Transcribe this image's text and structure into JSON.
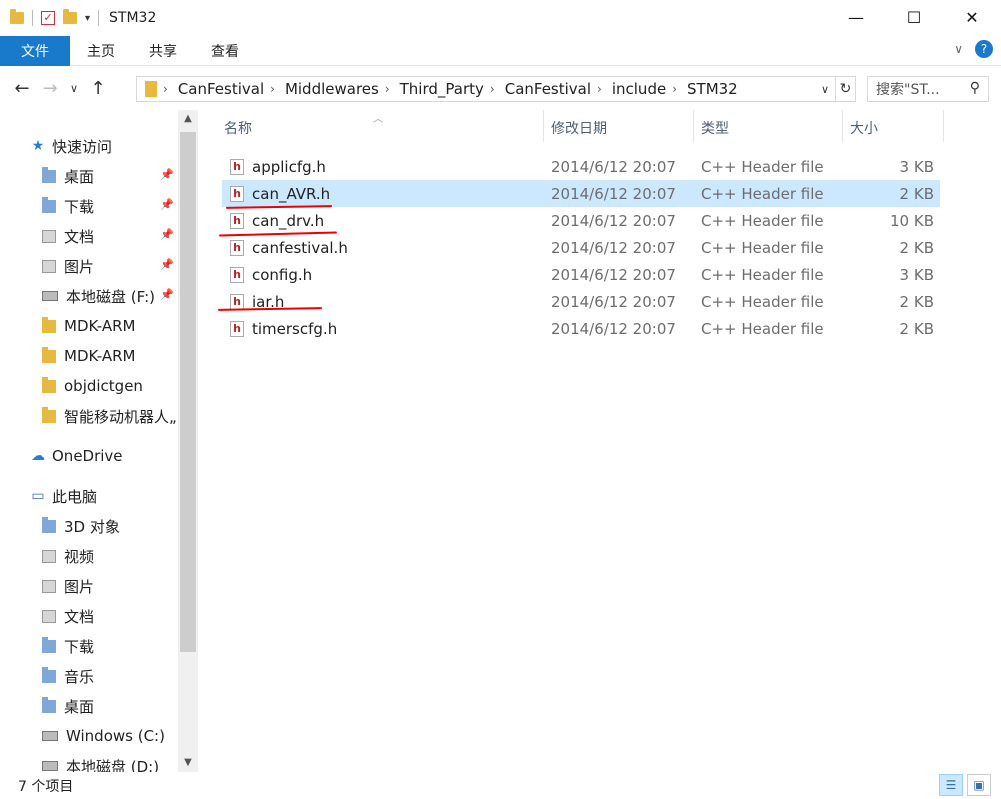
{
  "window": {
    "title": "STM32",
    "controls": {
      "minimize": "—",
      "maximize": "☐",
      "close": "✕"
    }
  },
  "ribbon": {
    "tabs": [
      "文件",
      "主页",
      "共享",
      "查看"
    ],
    "expand": "∨",
    "help": "?"
  },
  "nav": {
    "back": "←",
    "forward": "→",
    "recent": "∨",
    "up": "↑"
  },
  "address": {
    "crumbs": [
      "CanFestival",
      "Middlewares",
      "Third_Party",
      "CanFestival",
      "include",
      "STM32"
    ],
    "dropdown": "∨",
    "refresh": "↻"
  },
  "search": {
    "placeholder": "搜索\"ST...",
    "icon": "search-icon"
  },
  "sidebar": {
    "items": [
      {
        "label": "快速访问",
        "icon": "star-icon",
        "pinned": false
      },
      {
        "label": "桌面",
        "icon": "desktop-folder-icon",
        "pinned": true
      },
      {
        "label": "下载",
        "icon": "download-folder-icon",
        "pinned": true
      },
      {
        "label": "文档",
        "icon": "documents-folder-icon",
        "pinned": true
      },
      {
        "label": "图片",
        "icon": "pictures-folder-icon",
        "pinned": true
      },
      {
        "label": "本地磁盘 (F:)",
        "icon": "drive-icon",
        "pinned": true
      },
      {
        "label": "MDK-ARM",
        "icon": "folder-icon",
        "pinned": false
      },
      {
        "label": "MDK-ARM",
        "icon": "folder-icon",
        "pinned": false
      },
      {
        "label": "objdictgen",
        "icon": "folder-icon",
        "pinned": false
      },
      {
        "label": "智能移动机器人„",
        "icon": "folder-icon",
        "pinned": false
      },
      {
        "label": "OneDrive",
        "icon": "cloud-icon",
        "pinned": false
      },
      {
        "label": "此电脑",
        "icon": "computer-icon",
        "pinned": false
      },
      {
        "label": "3D 对象",
        "icon": "3d-folder-icon",
        "pinned": false
      },
      {
        "label": "视频",
        "icon": "video-folder-icon",
        "pinned": false
      },
      {
        "label": "图片",
        "icon": "pictures-folder-icon",
        "pinned": false
      },
      {
        "label": "文档",
        "icon": "documents-folder-icon",
        "pinned": false
      },
      {
        "label": "下载",
        "icon": "download-folder-icon",
        "pinned": false
      },
      {
        "label": "音乐",
        "icon": "music-folder-icon",
        "pinned": false
      },
      {
        "label": "桌面",
        "icon": "desktop-folder-icon",
        "pinned": false
      },
      {
        "label": "Windows (C:)",
        "icon": "windows-drive-icon",
        "pinned": false
      },
      {
        "label": "本地磁盘 (D:)",
        "icon": "drive-icon",
        "pinned": false
      }
    ]
  },
  "columns": {
    "name": "名称",
    "date": "修改日期",
    "type": "类型",
    "size": "大小"
  },
  "files": [
    {
      "name": "applicfg.h",
      "date": "2014/6/12 20:07",
      "type": "C++ Header file",
      "size": "3 KB",
      "selected": false
    },
    {
      "name": "can_AVR.h",
      "date": "2014/6/12 20:07",
      "type": "C++ Header file",
      "size": "2 KB",
      "selected": true
    },
    {
      "name": "can_drv.h",
      "date": "2014/6/12 20:07",
      "type": "C++ Header file",
      "size": "10 KB",
      "selected": false
    },
    {
      "name": "canfestival.h",
      "date": "2014/6/12 20:07",
      "type": "C++ Header file",
      "size": "2 KB",
      "selected": false
    },
    {
      "name": "config.h",
      "date": "2014/6/12 20:07",
      "type": "C++ Header file",
      "size": "3 KB",
      "selected": false
    },
    {
      "name": "iar.h",
      "date": "2014/6/12 20:07",
      "type": "C++ Header file",
      "size": "2 KB",
      "selected": false
    },
    {
      "name": "timerscfg.h",
      "date": "2014/6/12 20:07",
      "type": "C++ Header file",
      "size": "2 KB",
      "selected": false
    }
  ],
  "status": {
    "count": "7 个项目"
  },
  "colors": {
    "accent": "#1979ca",
    "selection": "#cce8ff",
    "annotation": "#e00000"
  }
}
